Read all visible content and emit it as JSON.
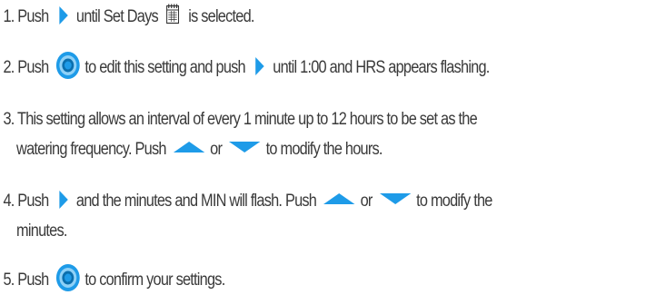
{
  "steps": [
    {
      "number": "1.",
      "segments": [
        "Push",
        "until Set Days",
        "is selected."
      ],
      "icons": [
        "right-arrow-icon",
        "calendar-icon"
      ]
    },
    {
      "number": "2.",
      "segments": [
        "Push",
        "to edit this setting and push",
        "until 1:00 and HRS appears flashing."
      ],
      "icons": [
        "dial-button-icon",
        "right-arrow-icon"
      ]
    },
    {
      "number": "3.",
      "segments": [
        "This setting allows an interval of every 1 minute up to 12 hours to be set as the",
        "watering frequency. Push",
        "or",
        "to modify the hours."
      ],
      "icons": [
        "up-arrow-icon",
        "down-arrow-icon"
      ]
    },
    {
      "number": "4.",
      "segments": [
        "Push",
        "and the minutes and MIN will flash. Push",
        "or",
        "to modify the",
        "minutes."
      ],
      "icons": [
        "right-arrow-icon",
        "up-arrow-icon",
        "down-arrow-icon"
      ]
    },
    {
      "number": "5.",
      "segments": [
        "Push",
        "to confirm your settings."
      ],
      "icons": [
        "dial-button-icon"
      ]
    }
  ],
  "colors": {
    "text": "#3a3a3a",
    "icon_fill": "#1e9be8",
    "icon_light": "#8fd1f7",
    "icon_dark": "#0b6fae"
  }
}
